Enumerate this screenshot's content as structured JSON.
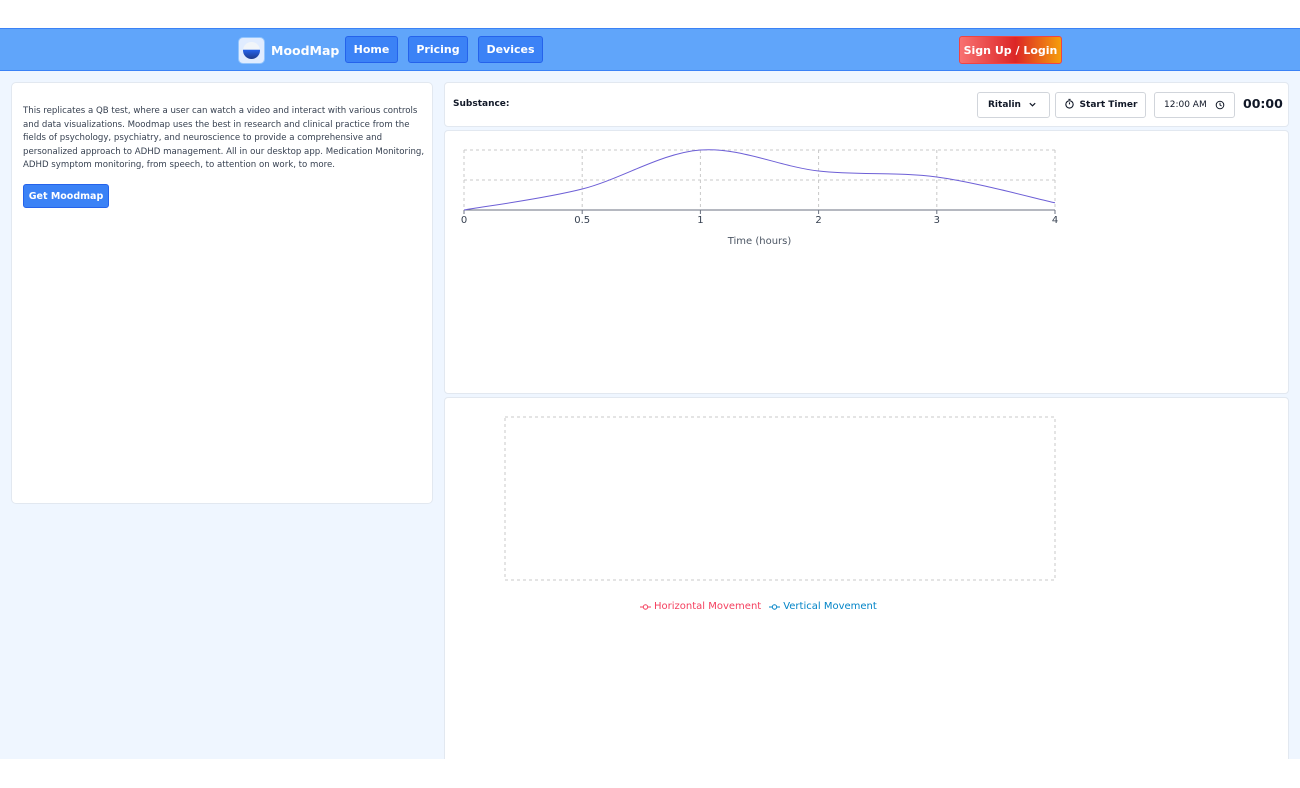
{
  "navbar": {
    "brand": "MoodMap",
    "items": [
      {
        "label": "Home"
      },
      {
        "label": "Pricing"
      },
      {
        "label": "Devices"
      }
    ],
    "signup_label": "Sign Up / Login"
  },
  "intro": {
    "description": "This replicates a QB test, where a user can watch a video and interact with various controls and data visualizations. Moodmap uses the best in research and clinical practice from the fields of psychology, psychiatry, and neuroscience to provide a comprehensive and personalized approach to ADHD management. All in our desktop app. Medication Monitoring, ADHD symptom monitoring, from speech, to attention on work, to more.",
    "cta_label": "Get Moodmap"
  },
  "controls": {
    "substance_label": "Substance:",
    "substance_value": "Ritalin",
    "start_timer_label": "Start Timer",
    "time_value": "12:00 AM",
    "timer_display": "00:00"
  },
  "chart_data": [
    {
      "type": "line",
      "title": "",
      "xlabel": "Time (hours)",
      "ylabel": "",
      "x_ticks": [
        "0",
        "0.5",
        "1",
        "2",
        "3",
        "4"
      ],
      "x": [
        0,
        0.5,
        1,
        2,
        3,
        4
      ],
      "series": [
        {
          "values": [
            0,
            0.35,
            1,
            0.65,
            0.55,
            0.12
          ]
        }
      ],
      "ylim": [
        0,
        1
      ],
      "grid": true,
      "color": "#6d5fd6"
    },
    {
      "type": "line",
      "title": "",
      "x": [],
      "series": [
        {
          "name": "Horizontal Movement",
          "values": [],
          "color": "#f43f5e"
        },
        {
          "name": "Vertical Movement",
          "values": [],
          "color": "#0284c7"
        }
      ],
      "grid": true,
      "legend": "bottom"
    }
  ]
}
